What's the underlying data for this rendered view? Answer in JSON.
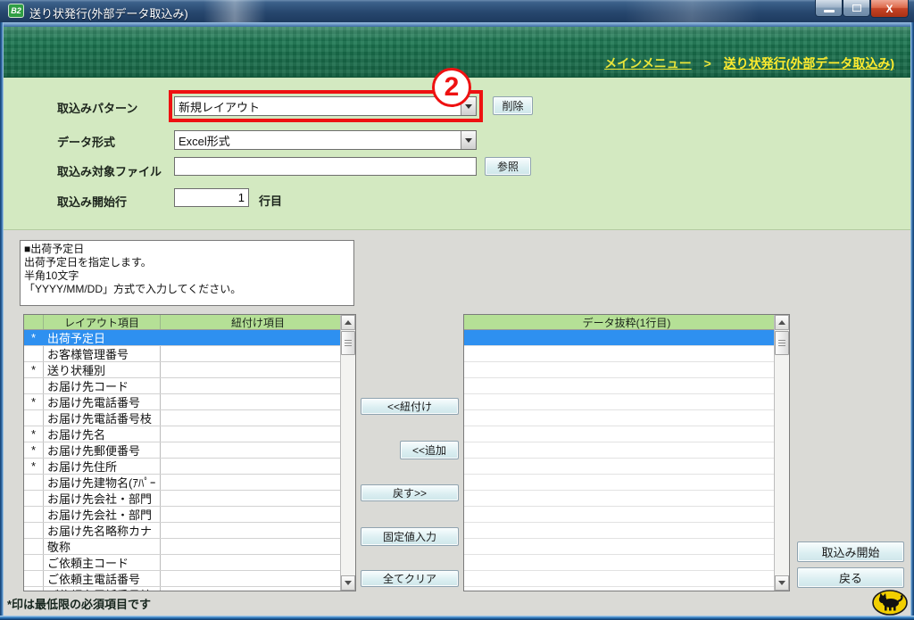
{
  "window": {
    "icon_label": "B2",
    "title": "送り状発行(外部データ取込み)",
    "close_glyph": "X"
  },
  "breadcrumb": {
    "main_menu_label": "メインメニュー",
    "separator": ">",
    "current_label": "送り状発行(外部データ取込み)"
  },
  "form": {
    "pattern_label": "取込みパターン",
    "pattern_value": "新規レイアウト",
    "delete_button_label": "削除",
    "format_label": "データ形式",
    "format_value": "Excel形式",
    "file_label": "取込み対象ファイル",
    "file_value": "",
    "browse_button_label": "参照",
    "start_row_label": "取込み開始行",
    "start_row_value": "1",
    "start_row_suffix": "行目"
  },
  "annotation": {
    "step_number": "2",
    "color": "#ee1111"
  },
  "description_box": {
    "line1": "■出荷予定日",
    "line2": "出荷予定日を指定します。",
    "line3": "半角10文字",
    "line4": "「YYYY/MM/DD」方式で入力してください。"
  },
  "layout_table": {
    "headers": {
      "required": "",
      "item": "レイアウト項目",
      "mapped": "紐付け項目"
    },
    "rows": [
      {
        "required": "*",
        "item": "出荷予定日",
        "mapped": "",
        "selected": true
      },
      {
        "required": "",
        "item": "お客様管理番号",
        "mapped": ""
      },
      {
        "required": "*",
        "item": "送り状種別",
        "mapped": ""
      },
      {
        "required": "",
        "item": "お届け先コード",
        "mapped": ""
      },
      {
        "required": "*",
        "item": "お届け先電話番号",
        "mapped": ""
      },
      {
        "required": "",
        "item": "お届け先電話番号枝",
        "mapped": ""
      },
      {
        "required": "*",
        "item": "お届け先名",
        "mapped": ""
      },
      {
        "required": "*",
        "item": "お届け先郵便番号",
        "mapped": ""
      },
      {
        "required": "*",
        "item": "お届け先住所",
        "mapped": ""
      },
      {
        "required": "",
        "item": "お届け先建物名(ｱﾊﾟｰ",
        "mapped": ""
      },
      {
        "required": "",
        "item": "お届け先会社・部門",
        "mapped": ""
      },
      {
        "required": "",
        "item": "お届け先会社・部門",
        "mapped": ""
      },
      {
        "required": "",
        "item": "お届け先名略称カナ",
        "mapped": ""
      },
      {
        "required": "",
        "item": "敬称",
        "mapped": ""
      },
      {
        "required": "",
        "item": "ご依頼主コード",
        "mapped": ""
      },
      {
        "required": "",
        "item": "ご依頼主電話番号",
        "mapped": ""
      },
      {
        "required": "",
        "item": "ご依頼主電話番号枝",
        "mapped": ""
      }
    ]
  },
  "transfer_buttons": {
    "map_label": "<<紐付け",
    "add_label": "<<追加",
    "undo_label": "戻す>>",
    "fixed_value_label": "固定値入力",
    "clear_all_label": "全てクリア"
  },
  "extract_table": {
    "header": "データ抜粋(1行目)",
    "visible_rows": 17
  },
  "footer": {
    "required_note": "*印は最低限の必須項目です"
  },
  "actions": {
    "start_import_label": "取込み開始",
    "back_label": "戻る"
  },
  "colors": {
    "selection_blue": "#2e90f0",
    "table_header_green": "#b5e096",
    "band_green": "#1a7550",
    "form_panel_green": "#d3e9c1",
    "annotation_red": "#ee1111",
    "breadcrumb_yellow": "#e9e53a"
  }
}
